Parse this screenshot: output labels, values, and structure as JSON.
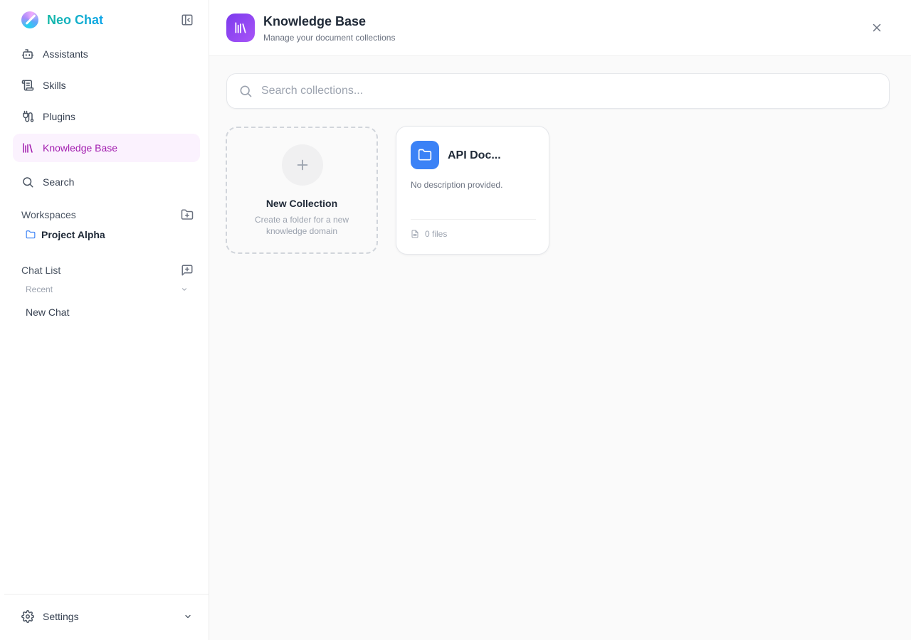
{
  "app": {
    "name": "Neo Chat"
  },
  "nav": {
    "assistants": "Assistants",
    "skills": "Skills",
    "plugins": "Plugins",
    "knowledge_base": "Knowledge Base",
    "search": "Search"
  },
  "workspaces": {
    "title": "Workspaces",
    "items": [
      {
        "label": "Project Alpha"
      }
    ]
  },
  "chat_list": {
    "title": "Chat List",
    "group_label": "Recent",
    "items": [
      {
        "label": "New Chat"
      }
    ]
  },
  "settings": {
    "label": "Settings"
  },
  "header": {
    "title": "Knowledge Base",
    "subtitle": "Manage your document collections"
  },
  "search": {
    "placeholder": "Search collections...",
    "value": ""
  },
  "new_collection": {
    "title": "New Collection",
    "description": "Create a folder for a new knowledge domain"
  },
  "collections": [
    {
      "title": "API Doc...",
      "description": "No description provided.",
      "files": "0 files"
    }
  ],
  "colors": {
    "active_accent": "#a21caf",
    "active_bg": "#fbf2fe",
    "header_icon": "#7c3aed",
    "folder_icon": "#3b82f6",
    "brand_gradient_start": "#14b8a6",
    "brand_gradient_end": "#0ea5e9"
  },
  "icons": {
    "brand": "neo-chat-logo",
    "collapse": "sidebar-collapse-icon",
    "assistants": "robot-icon",
    "skills": "scroll-icon",
    "plugins": "plug-icon",
    "knowledge_base": "library-icon",
    "search": "search-icon",
    "workspace_add": "folder-plus-icon",
    "chat_add": "message-plus-icon",
    "settings": "gear-icon",
    "close": "close-icon"
  }
}
